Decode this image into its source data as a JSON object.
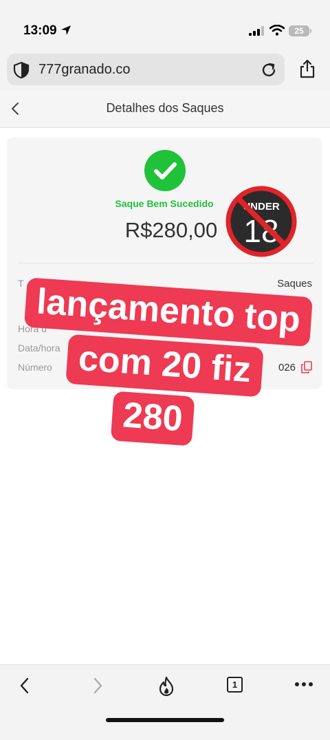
{
  "status_bar": {
    "time": "13:09",
    "battery": "25"
  },
  "browser": {
    "url": "777granado.co"
  },
  "header": {
    "title": "Detalhes dos Saques"
  },
  "card": {
    "status": "Saque Bem Sucedido",
    "amount": "R$280,00",
    "rows": [
      {
        "label": "T",
        "value": "Saques"
      },
      {
        "label": "Hora d",
        "value": ""
      },
      {
        "label": "Data/hora",
        "value": ""
      },
      {
        "label": "Número",
        "value": "026"
      }
    ]
  },
  "badge": {
    "text_top": "UNDER",
    "text_num": "18"
  },
  "overlay": {
    "lines": [
      "lançamento top",
      "com 20 fiz",
      "280"
    ]
  },
  "colors": {
    "success": "#1fc238",
    "overlay_bg": "#ee3a52",
    "badge_red": "#e2232a"
  },
  "toolbar": {
    "tabs_count": "1"
  }
}
